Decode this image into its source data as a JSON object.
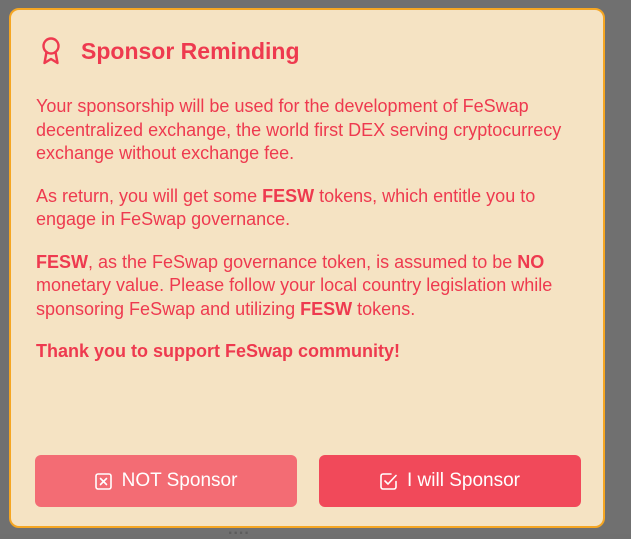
{
  "backdrop": {
    "partial_text": "...."
  },
  "modal": {
    "icon": "award-ribbon-icon",
    "title": "Sponsor Reminding",
    "paragraph1": "Your sponsorship will be used for the development of FeSwap decentralized exchange, the world first DEX serving cryptocurrecy exchange without exchange fee.",
    "paragraph2": {
      "before": "As return, you will get some ",
      "token": "FESW",
      "after": " tokens, which entitle you to engage in FeSwap governance."
    },
    "paragraph3": {
      "token1": "FESW",
      "part1": ", as the FeSwap governance token, is assumed to be ",
      "no": "NO",
      "part2": " monetary value. Please follow your local country legislation while sponsoring FeSwap and utilizing ",
      "token2": "FESW",
      "part3": " tokens."
    },
    "thanks": "Thank you to support FeSwap community!",
    "buttons": {
      "not_sponsor": {
        "label": "NOT Sponsor",
        "icon": "x-square-icon"
      },
      "will_sponsor": {
        "label": "I will Sponsor",
        "icon": "check-square-icon"
      }
    }
  },
  "colors": {
    "modal_bg": "#f5e3c3",
    "modal_border": "#f5a623",
    "accent_text": "#ee3a4f",
    "button_not": "#f36c74",
    "button_will": "#f1495a",
    "overlay": "#707070"
  }
}
